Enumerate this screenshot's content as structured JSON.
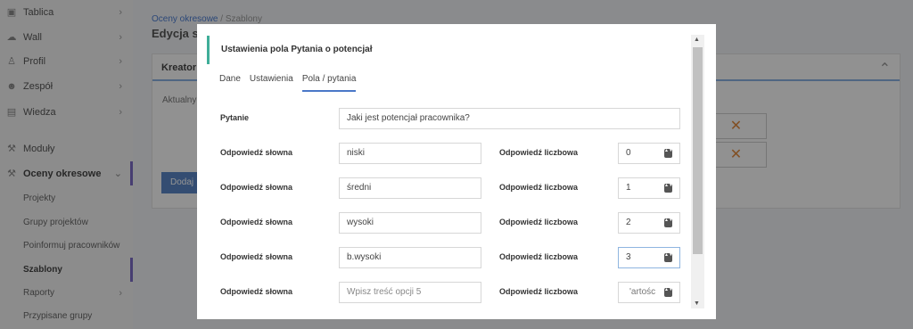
{
  "sidebar": {
    "items": [
      {
        "label": "Tablica",
        "icon": "dashboard-icon",
        "chevron": "›"
      },
      {
        "label": "Wall",
        "icon": "chat-icon",
        "chevron": "›"
      },
      {
        "label": "Profil",
        "icon": "user-icon",
        "chevron": "›"
      },
      {
        "label": "Zespół",
        "icon": "team-icon",
        "chevron": "›"
      },
      {
        "label": "Wiedza",
        "icon": "book-icon",
        "chevron": "›"
      },
      {
        "label": "Moduły",
        "icon": "wrench-icon",
        "chevron": ""
      },
      {
        "label": "Oceny okresowe",
        "icon": "wrench-icon",
        "chevron": "⌄"
      }
    ],
    "sub_items": [
      {
        "label": "Projekty",
        "chevron": ""
      },
      {
        "label": "Grupy projektów",
        "chevron": ""
      },
      {
        "label": "Poinformuj pracowników",
        "chevron": ""
      },
      {
        "label": "Szablony",
        "chevron": ""
      },
      {
        "label": "Raporty",
        "chevron": "›"
      },
      {
        "label": "Przypisane grupy",
        "chevron": ""
      }
    ]
  },
  "breadcrumb": {
    "link": "Oceny okresowe",
    "separator": " / ",
    "current": "Szablony"
  },
  "page_title": "Edycja sz",
  "panel": {
    "title": "Kreator",
    "aktualne": "Aktualny",
    "add_button": "Dodaj",
    "remove_icon": "✕",
    "collapse_icon": "⌃"
  },
  "modal": {
    "title": "Ustawienia pola Pytania o potencjał",
    "close_icon": "×",
    "tabs": [
      {
        "label": "Dane"
      },
      {
        "label": "Ustawienia"
      },
      {
        "label": "Pola / pytania"
      }
    ],
    "question_label": "Pytanie",
    "question_value": "Jaki jest potencjał pracownika?",
    "answers": [
      {
        "verbal_label": "Odpowiedź słowna",
        "verbal_value": "niski",
        "numeric_label": "Odpowiedź liczbowa",
        "numeric_value": "0"
      },
      {
        "verbal_label": "Odpowiedź słowna",
        "verbal_value": "średni",
        "numeric_label": "Odpowiedź liczbowa",
        "numeric_value": "1"
      },
      {
        "verbal_label": "Odpowiedź słowna",
        "verbal_value": "wysoki",
        "numeric_label": "Odpowiedź liczbowa",
        "numeric_value": "2"
      },
      {
        "verbal_label": "Odpowiedź słowna",
        "verbal_value": "b.wysoki",
        "numeric_label": "Odpowiedź liczbowa",
        "numeric_value": "3"
      },
      {
        "verbal_label": "Odpowiedź słowna",
        "verbal_placeholder": "Wpisz treść opcji 5",
        "numeric_label": "Odpowiedź liczbowa",
        "numeric_placeholder": "'artośc"
      }
    ],
    "spinner_glyph": "▲▼"
  },
  "scroll": {
    "up": "▲",
    "down": "▼"
  },
  "colors": {
    "accent": "#3fae99",
    "tab_active": "#4a78c8",
    "sidebar_marker": "#7b6cc5",
    "remove": "#e08a3e"
  }
}
